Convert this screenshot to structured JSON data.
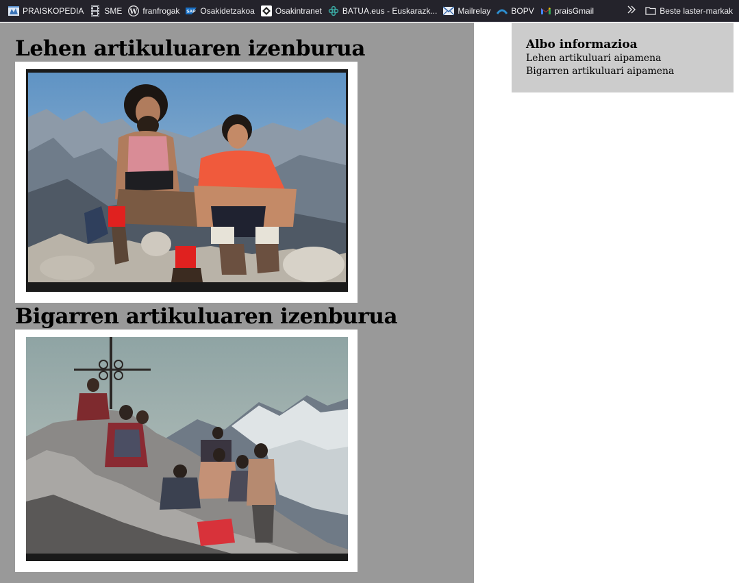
{
  "bookmarks": [
    {
      "label": "PRAISKOPEDIA",
      "icon": "wiki-icon"
    },
    {
      "label": "SME",
      "icon": "film-strip-icon"
    },
    {
      "label": "franfrogak",
      "icon": "wordpress-icon"
    },
    {
      "label": "Osakidetzakoa",
      "icon": "sap-icon"
    },
    {
      "label": "Osakintranet",
      "icon": "osakintranet-icon"
    },
    {
      "label": "BATUA.eus - Euskarazk...",
      "icon": "batua-icon"
    },
    {
      "label": "Mailrelay",
      "icon": "mail-icon"
    },
    {
      "label": "BOPV",
      "icon": "bopv-icon"
    },
    {
      "label": "praisGmail",
      "icon": "gmail-icon"
    }
  ],
  "other_bookmarks_label": "Beste laster-markak",
  "articles": [
    {
      "title": "Lehen artikuluaren izenburua",
      "photo": "Two climbers sitting on rocks on a mountain summit"
    },
    {
      "title": "Bigarren artikuluaren izenburua",
      "photo": "Group of climbers on a rocky summit with an iron cross"
    }
  ],
  "aside": {
    "title": "Albo informazioa",
    "items": [
      "Lehen artikuluari aipamena",
      "Bigarren artikuluari aipamena"
    ]
  },
  "colors": {
    "bookmarks_bar": "#24232b",
    "main_background": "#999999",
    "aside_background": "#cccccc",
    "photo_frame": "#ffffff"
  }
}
